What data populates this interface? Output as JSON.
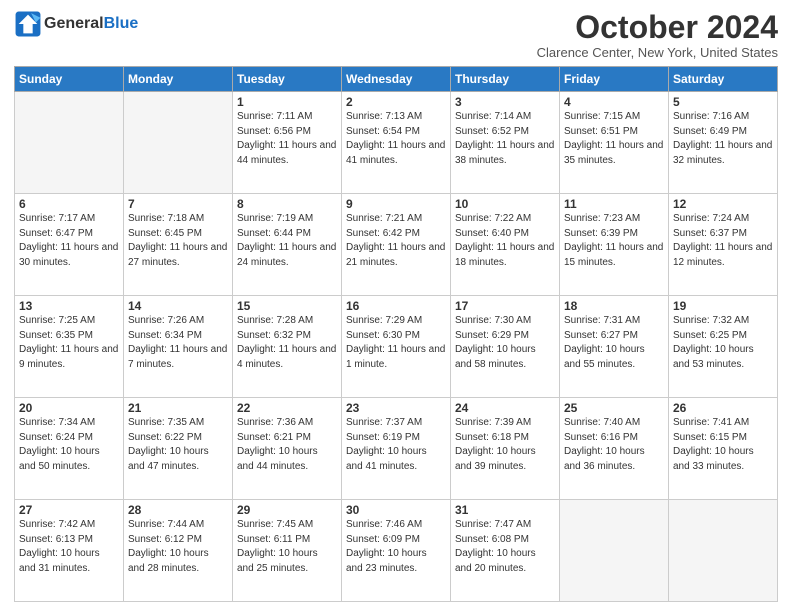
{
  "header": {
    "logo_line1": "General",
    "logo_line2": "Blue",
    "month_title": "October 2024",
    "location": "Clarence Center, New York, United States"
  },
  "days_of_week": [
    "Sunday",
    "Monday",
    "Tuesday",
    "Wednesday",
    "Thursday",
    "Friday",
    "Saturday"
  ],
  "weeks": [
    [
      {
        "day": "",
        "empty": true
      },
      {
        "day": "",
        "empty": true
      },
      {
        "day": "1",
        "sunrise": "7:11 AM",
        "sunset": "6:56 PM",
        "daylight": "11 hours and 44 minutes."
      },
      {
        "day": "2",
        "sunrise": "7:13 AM",
        "sunset": "6:54 PM",
        "daylight": "11 hours and 41 minutes."
      },
      {
        "day": "3",
        "sunrise": "7:14 AM",
        "sunset": "6:52 PM",
        "daylight": "11 hours and 38 minutes."
      },
      {
        "day": "4",
        "sunrise": "7:15 AM",
        "sunset": "6:51 PM",
        "daylight": "11 hours and 35 minutes."
      },
      {
        "day": "5",
        "sunrise": "7:16 AM",
        "sunset": "6:49 PM",
        "daylight": "11 hours and 32 minutes."
      }
    ],
    [
      {
        "day": "6",
        "sunrise": "7:17 AM",
        "sunset": "6:47 PM",
        "daylight": "11 hours and 30 minutes."
      },
      {
        "day": "7",
        "sunrise": "7:18 AM",
        "sunset": "6:45 PM",
        "daylight": "11 hours and 27 minutes."
      },
      {
        "day": "8",
        "sunrise": "7:19 AM",
        "sunset": "6:44 PM",
        "daylight": "11 hours and 24 minutes."
      },
      {
        "day": "9",
        "sunrise": "7:21 AM",
        "sunset": "6:42 PM",
        "daylight": "11 hours and 21 minutes."
      },
      {
        "day": "10",
        "sunrise": "7:22 AM",
        "sunset": "6:40 PM",
        "daylight": "11 hours and 18 minutes."
      },
      {
        "day": "11",
        "sunrise": "7:23 AM",
        "sunset": "6:39 PM",
        "daylight": "11 hours and 15 minutes."
      },
      {
        "day": "12",
        "sunrise": "7:24 AM",
        "sunset": "6:37 PM",
        "daylight": "11 hours and 12 minutes."
      }
    ],
    [
      {
        "day": "13",
        "sunrise": "7:25 AM",
        "sunset": "6:35 PM",
        "daylight": "11 hours and 9 minutes."
      },
      {
        "day": "14",
        "sunrise": "7:26 AM",
        "sunset": "6:34 PM",
        "daylight": "11 hours and 7 minutes."
      },
      {
        "day": "15",
        "sunrise": "7:28 AM",
        "sunset": "6:32 PM",
        "daylight": "11 hours and 4 minutes."
      },
      {
        "day": "16",
        "sunrise": "7:29 AM",
        "sunset": "6:30 PM",
        "daylight": "11 hours and 1 minute."
      },
      {
        "day": "17",
        "sunrise": "7:30 AM",
        "sunset": "6:29 PM",
        "daylight": "10 hours and 58 minutes."
      },
      {
        "day": "18",
        "sunrise": "7:31 AM",
        "sunset": "6:27 PM",
        "daylight": "10 hours and 55 minutes."
      },
      {
        "day": "19",
        "sunrise": "7:32 AM",
        "sunset": "6:25 PM",
        "daylight": "10 hours and 53 minutes."
      }
    ],
    [
      {
        "day": "20",
        "sunrise": "7:34 AM",
        "sunset": "6:24 PM",
        "daylight": "10 hours and 50 minutes."
      },
      {
        "day": "21",
        "sunrise": "7:35 AM",
        "sunset": "6:22 PM",
        "daylight": "10 hours and 47 minutes."
      },
      {
        "day": "22",
        "sunrise": "7:36 AM",
        "sunset": "6:21 PM",
        "daylight": "10 hours and 44 minutes."
      },
      {
        "day": "23",
        "sunrise": "7:37 AM",
        "sunset": "6:19 PM",
        "daylight": "10 hours and 41 minutes."
      },
      {
        "day": "24",
        "sunrise": "7:39 AM",
        "sunset": "6:18 PM",
        "daylight": "10 hours and 39 minutes."
      },
      {
        "day": "25",
        "sunrise": "7:40 AM",
        "sunset": "6:16 PM",
        "daylight": "10 hours and 36 minutes."
      },
      {
        "day": "26",
        "sunrise": "7:41 AM",
        "sunset": "6:15 PM",
        "daylight": "10 hours and 33 minutes."
      }
    ],
    [
      {
        "day": "27",
        "sunrise": "7:42 AM",
        "sunset": "6:13 PM",
        "daylight": "10 hours and 31 minutes."
      },
      {
        "day": "28",
        "sunrise": "7:44 AM",
        "sunset": "6:12 PM",
        "daylight": "10 hours and 28 minutes."
      },
      {
        "day": "29",
        "sunrise": "7:45 AM",
        "sunset": "6:11 PM",
        "daylight": "10 hours and 25 minutes."
      },
      {
        "day": "30",
        "sunrise": "7:46 AM",
        "sunset": "6:09 PM",
        "daylight": "10 hours and 23 minutes."
      },
      {
        "day": "31",
        "sunrise": "7:47 AM",
        "sunset": "6:08 PM",
        "daylight": "10 hours and 20 minutes."
      },
      {
        "day": "",
        "empty": true
      },
      {
        "day": "",
        "empty": true
      }
    ]
  ],
  "labels": {
    "sunrise": "Sunrise:",
    "sunset": "Sunset:",
    "daylight": "Daylight:"
  }
}
